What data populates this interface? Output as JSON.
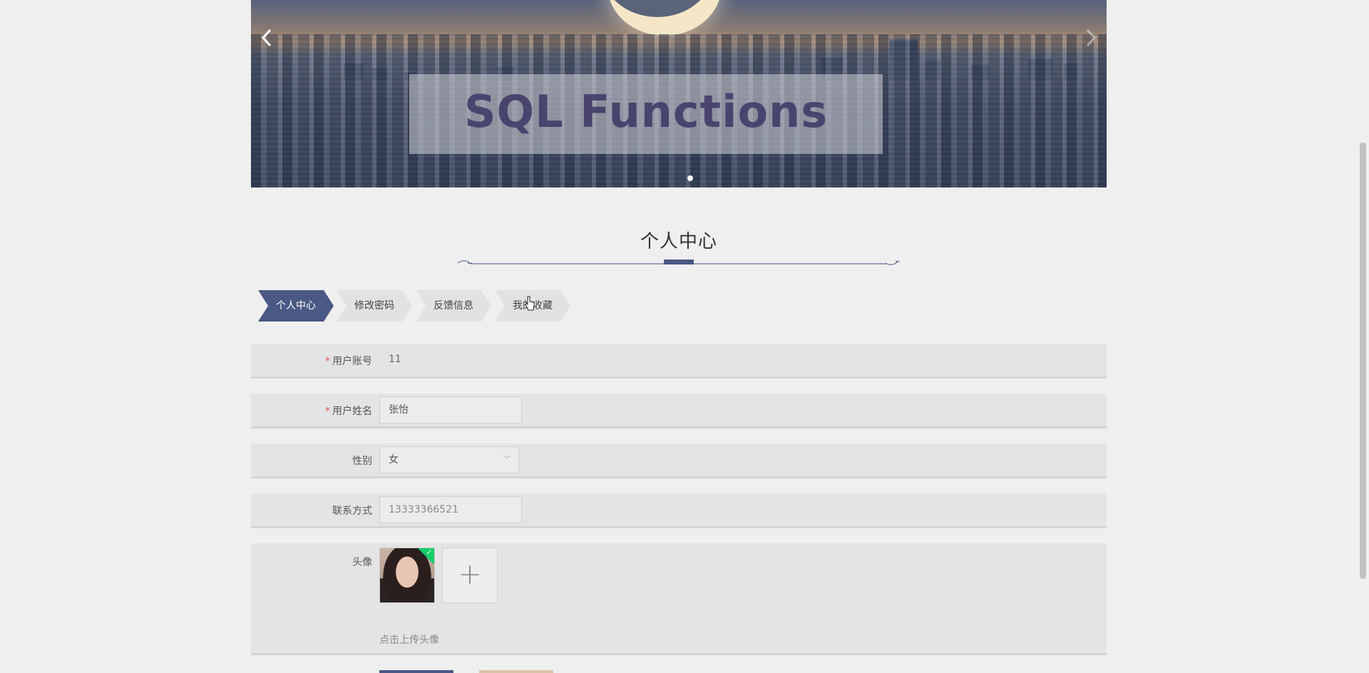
{
  "banner": {
    "image_text": "SQL Functions",
    "prev_icon": "chevron-left-icon",
    "next_icon": "chevron-right-icon",
    "active_slide": 1
  },
  "section": {
    "title": "个人中心"
  },
  "tabs": [
    {
      "label": "个人中心",
      "active": true
    },
    {
      "label": "修改密码",
      "active": false
    },
    {
      "label": "反馈信息",
      "active": false
    },
    {
      "label": "我的收藏",
      "active": false
    }
  ],
  "form": {
    "account": {
      "label": "用户账号",
      "required_mark": "*",
      "value": "11"
    },
    "name": {
      "label": "用户姓名",
      "required_mark": "*",
      "value": "张怡"
    },
    "gender": {
      "label": "性别",
      "value": "女",
      "caret": "﹀"
    },
    "phone": {
      "label": "联系方式",
      "value": "13333366521"
    },
    "avatar": {
      "label": "头像",
      "upload_symbol": "+",
      "hint": "点击上传头像",
      "check_mark": "✓"
    }
  },
  "colors": {
    "accent": "#4a5885",
    "required": "#e05a5a",
    "success": "#13ce66",
    "background": "#efefef"
  }
}
